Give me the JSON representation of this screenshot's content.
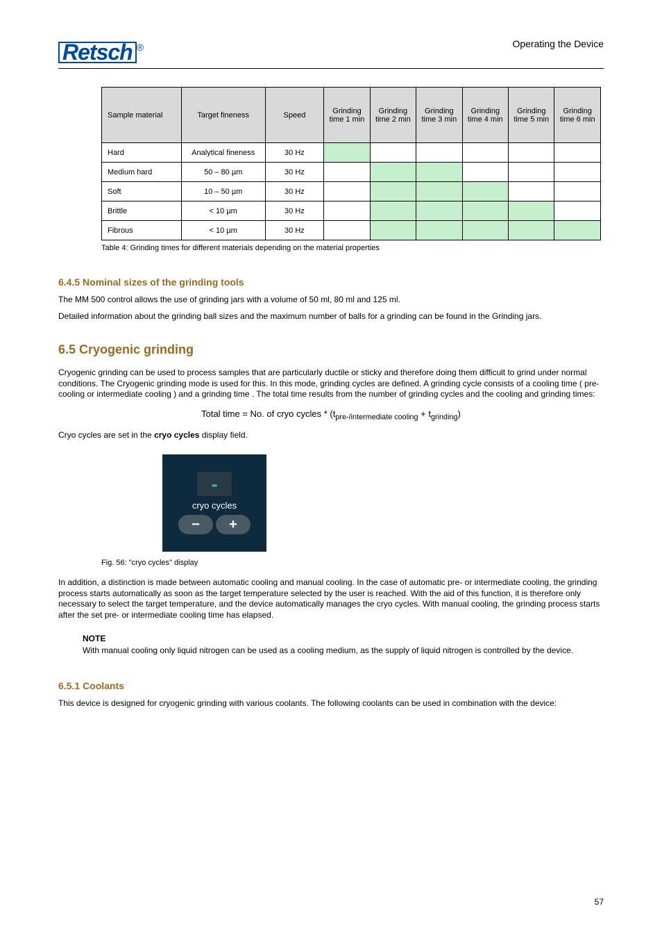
{
  "header": {
    "brand_full": "Retsch",
    "brand_reg": "®"
  },
  "table": {
    "headers": {
      "sample": "Sample material",
      "fineness": "Target fineness",
      "speed": "Speed",
      "h1": "1",
      "h2": "2",
      "h3": "3",
      "h4": "4",
      "h5": "5",
      "h6": "6"
    },
    "rows": [
      {
        "c0": "Hard",
        "c1": "Analytical fineness",
        "c2": "30 Hz",
        "c3": "",
        "c4": "",
        "c5": "",
        "c6": "",
        "c7": "",
        "c8": "",
        "green": [
          3
        ]
      },
      {
        "c0": "Medium hard",
        "c1": "50 – 80 µm",
        "c2": "30 Hz",
        "c3": "",
        "c4": "",
        "c5": "",
        "c6": "",
        "c7": "",
        "c8": "",
        "green": [
          4,
          5
        ]
      },
      {
        "c0": "Soft",
        "c1": "10 – 50 µm",
        "c2": "30 Hz",
        "c3": "",
        "c4": "",
        "c5": "",
        "c6": "",
        "c7": "",
        "c8": "",
        "green": [
          4,
          5,
          6
        ]
      },
      {
        "c0": "Brittle",
        "c1": "< 10 µm",
        "c2": "30 Hz",
        "c3": "",
        "c4": "",
        "c5": "",
        "c6": "",
        "c7": "",
        "c8": "",
        "green": [
          4,
          5,
          6,
          7
        ]
      },
      {
        "c0": "Fibrous",
        "c1": "< 10 µm",
        "c2": "30 Hz",
        "c3": "",
        "c4": "",
        "c5": "",
        "c6": "",
        "c7": "",
        "c8": "",
        "green": [
          4,
          5,
          6,
          7,
          8
        ]
      }
    ],
    "caption": "Table 4: Grinding times for different materials depending on the material properties"
  },
  "section_nominal": {
    "title": "6.4.5 Nominal sizes of the grinding tools",
    "p1": "The MM 500 control allows the use of grinding jars with a volume of 50 ml, 80 ml and 125 ml.",
    "p2": "Detailed information about the grinding ball sizes and the maximum number of balls for a grinding can be found in the Grinding jars."
  },
  "cryo": {
    "title": "6.5 Cryogenic grinding",
    "p1": "Cryogenic grinding can be used to process samples that are particularly ductile or sticky and therefore doing them difficult to grind under normal conditions. The Cryogenic grinding mode is used for this. In this mode, grinding cycles are defined. A grinding cycle consists of a cooling time ( pre-cooling or intermediate cooling ) and a grinding time . The total time results from the number of grinding cycles and the cooling and grinding times:",
    "formula": "Total time = No. of cryo cycles * (t_pre-/intermediate cooling + t_grinding)",
    "p2": "Cryo cycles are set in the cryo cycles display field."
  },
  "cryo_fig": {
    "display": "-",
    "label": "cryo cycles",
    "btn_minus": "−",
    "btn_plus": "+",
    "caption": "Fig. 56: \"cryo cycles\" display"
  },
  "p_after_fig": "In addition, a distinction is made between automatic cooling and manual cooling. In the case of automatic pre- or intermediate cooling, the grinding process starts automatically as soon as the target temperature selected by the user is reached. With the aid of this function, it is therefore only necessary to select the target temperature, and the device automatically manages the cryo cycles. With manual cooling, the grinding process starts after the set pre- or intermediate cooling time has elapsed.",
  "note": {
    "title": "NOTE",
    "body": "With manual cooling only liquid nitrogen can be used as a cooling medium, as the supply of liquid nitrogen is controlled by the device."
  },
  "section_coolants": {
    "title": "6.5.1 Coolants",
    "p1": "This device is designed for cryogenic grinding with various coolants. The following coolants can be used in combination with the device:"
  },
  "page_num": "57"
}
